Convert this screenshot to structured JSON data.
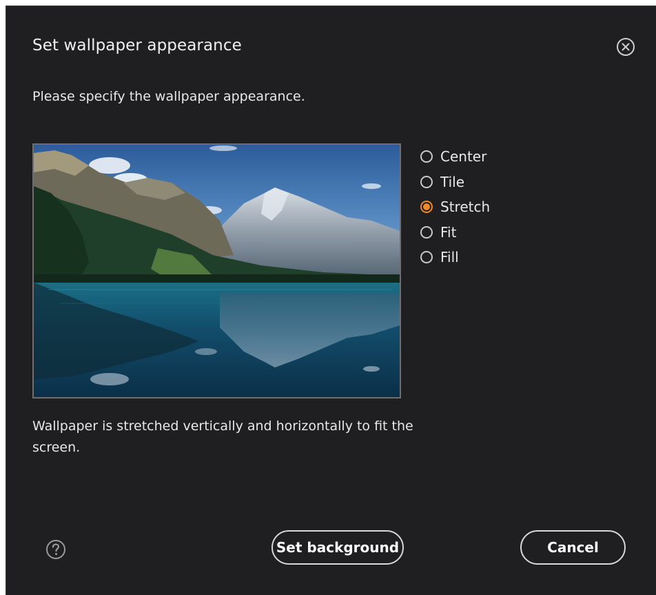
{
  "dialog": {
    "title": "Set wallpaper appearance",
    "subtitle": "Please specify the wallpaper appearance.",
    "description": "Wallpaper is stretched vertically and horizontally to fit the screen.",
    "close_icon": "close-circle-icon",
    "help_icon": "question-circle-icon"
  },
  "options": [
    {
      "label": "Center",
      "selected": false
    },
    {
      "label": "Tile",
      "selected": false
    },
    {
      "label": "Stretch",
      "selected": true
    },
    {
      "label": "Fit",
      "selected": false
    },
    {
      "label": "Fill",
      "selected": false
    }
  ],
  "buttons": {
    "set_background": "Set background",
    "cancel": "Cancel"
  },
  "colors": {
    "background": "#1f1e21",
    "accent": "#f08a23",
    "text": "#e8e8e8"
  }
}
